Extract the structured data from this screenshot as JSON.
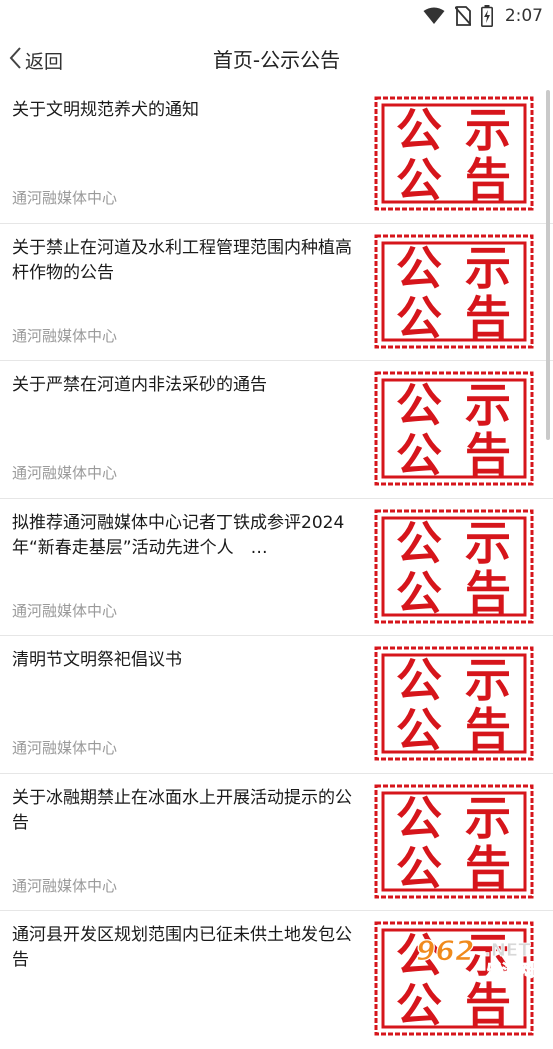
{
  "status_bar": {
    "time": "2:07",
    "icons": [
      "wifi-icon",
      "no-sim-icon",
      "battery-charging-icon"
    ]
  },
  "nav": {
    "back_label": "返回",
    "title": "首页-公示公告"
  },
  "articles": [
    {
      "title": "关于文明规范养犬的通知",
      "source": "通河融媒体中心",
      "thumb": "公示公告"
    },
    {
      "title": "关于禁止在河道及水利工程管理范围内种植高杆作物的公告",
      "source": "通河融媒体中心",
      "thumb": "公示公告"
    },
    {
      "title": "关于严禁在河道内非法采砂的通告",
      "source": "通河融媒体中心",
      "thumb": "公示公告"
    },
    {
      "title": "拟推荐通河融媒体中心记者丁铁成参评2024年“新春走基层”活动先进个人　…",
      "source": "通河融媒体中心",
      "thumb": "公示公告"
    },
    {
      "title": "清明节文明祭祀倡议书",
      "source": "通河融媒体中心",
      "thumb": "公示公告"
    },
    {
      "title": "关于冰融期禁止在冰面水上开展活动提示的公告",
      "source": "通河融媒体中心",
      "thumb": "公示公告"
    },
    {
      "title": "通河县开发区规划范围内已征未供土地发包公告",
      "source": "",
      "thumb": "公示公告"
    }
  ],
  "watermark": {
    "brand_number": "962",
    "brand_net": ".NET",
    "brand_sub": "乐游网"
  },
  "colors": {
    "stamp_red": "#d6151b",
    "source_gray": "#9a9a9a",
    "divider": "#e6e6e6"
  }
}
